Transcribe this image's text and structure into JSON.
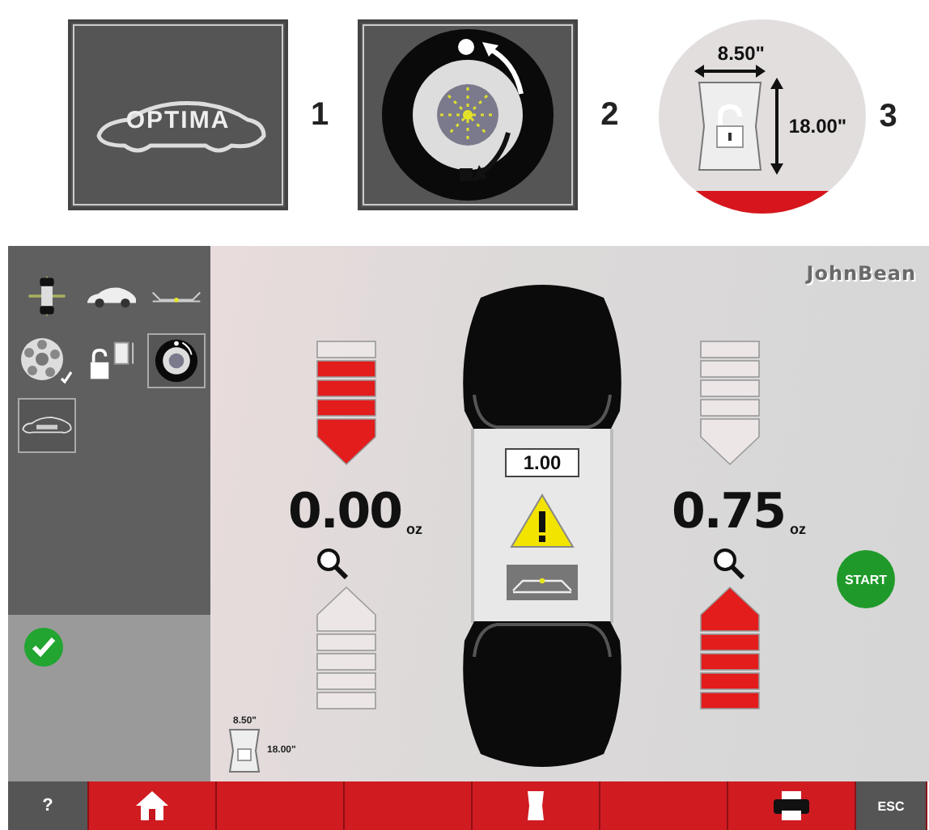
{
  "legend": [
    {
      "kind": "optima-logo",
      "logo_text": "OPTIMA",
      "number": "1"
    },
    {
      "kind": "wheel-spin",
      "number": "2"
    },
    {
      "kind": "dimension",
      "width": "8.50\"",
      "height": "18.00\"",
      "number": "3"
    }
  ],
  "brand": "JohnBean",
  "sidebar": {
    "icons": [
      {
        "kind": "axle",
        "selected": false
      },
      {
        "kind": "car",
        "selected": false
      },
      {
        "kind": "axle-line",
        "selected": false
      },
      {
        "kind": "alloy-wheel",
        "selected": false
      },
      {
        "kind": "lock-dimension",
        "selected": false
      },
      {
        "kind": "wheel-spin",
        "selected": true
      },
      {
        "kind": "car-outline",
        "selected": true
      }
    ],
    "status_ok": true
  },
  "left": {
    "upper_segments": [
      {
        "lit": false
      },
      {
        "lit": true
      },
      {
        "lit": true
      },
      {
        "lit": true
      },
      {
        "lit": true
      }
    ],
    "reading": "0.00",
    "unit": "oz",
    "lower_segments": [
      {
        "lit": false
      },
      {
        "lit": false
      },
      {
        "lit": false
      },
      {
        "lit": false
      },
      {
        "lit": false
      }
    ]
  },
  "right": {
    "upper_segments": [
      {
        "lit": false
      },
      {
        "lit": false
      },
      {
        "lit": false
      },
      {
        "lit": false
      },
      {
        "lit": false
      }
    ],
    "reading": "0.75",
    "unit": "oz",
    "lower_segments": [
      {
        "lit": true
      },
      {
        "lit": true
      },
      {
        "lit": true
      },
      {
        "lit": true
      },
      {
        "lit": true
      }
    ]
  },
  "center_value": "1.00",
  "dimension": {
    "width": "8.50\"",
    "height": "18.00\""
  },
  "start_label": "START",
  "toolbar": [
    {
      "kind": "text",
      "label": "?"
    },
    {
      "kind": "home"
    },
    {
      "kind": "blank"
    },
    {
      "kind": "blank"
    },
    {
      "kind": "weight"
    },
    {
      "kind": "blank"
    },
    {
      "kind": "printer"
    },
    {
      "kind": "text",
      "label": "ESC"
    }
  ]
}
